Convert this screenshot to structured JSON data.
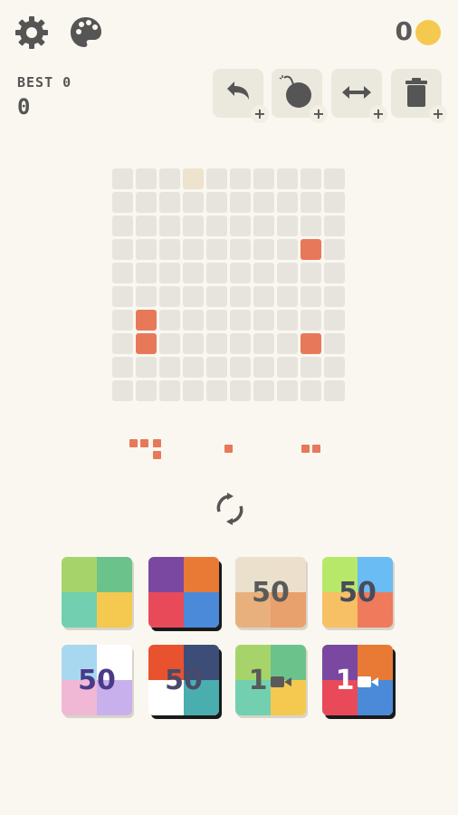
{
  "header": {
    "settings_icon": "gear-icon",
    "palette_icon": "palette-icon",
    "coins": "0",
    "coin_color": "#f5c84f"
  },
  "stats": {
    "best_label": "BEST 0",
    "score": "0"
  },
  "tools": [
    {
      "name": "undo",
      "icon": "undo-icon",
      "plus": "+"
    },
    {
      "name": "bomb",
      "icon": "bomb-icon",
      "plus": "+"
    },
    {
      "name": "swap",
      "icon": "swap-arrows-icon",
      "plus": "+"
    },
    {
      "name": "trash",
      "icon": "trash-icon",
      "plus": "+"
    }
  ],
  "board": {
    "rows": 10,
    "cols": 10,
    "empty_color": "#e6e4dc",
    "filled_color": "#e8785a",
    "highlight_color": "#eee3cd",
    "highlight_cells": [
      [
        0,
        3
      ]
    ],
    "filled_cells": [
      [
        3,
        8
      ],
      [
        6,
        1
      ],
      [
        7,
        1
      ],
      [
        7,
        8
      ]
    ]
  },
  "tray": {
    "piece_color": "#e8785a",
    "refresh_icon": "refresh-icon"
  },
  "themes": [
    {
      "colors": [
        "#a6d46a",
        "#6cc28b",
        "#72d0b0",
        "#f5c84f"
      ],
      "price": "",
      "style": "soft"
    },
    {
      "colors": [
        "#7a48a0",
        "#e87a35",
        "#e84a5a",
        "#4a8ad8"
      ],
      "style": "dark",
      "price": ""
    },
    {
      "colors": [
        "#eae0cc",
        "#ece0cc",
        "#e8b07c",
        "#e8a06c"
      ],
      "price": "50",
      "price_color": "#5a5a5a",
      "style": "soft"
    },
    {
      "colors": [
        "#b8e86a",
        "#6abcf4",
        "#f8c064",
        "#f07a5c"
      ],
      "price": "50",
      "price_color": "#4a4a5a",
      "style": "soft"
    },
    {
      "colors": [
        "#a8d8f0",
        "#ffffff",
        "#f0b8d4",
        "#c8b0ec"
      ],
      "price": "50",
      "price_color": "#4a3a8a",
      "style": "soft"
    },
    {
      "colors": [
        "#e8522e",
        "#3c4e78",
        "#ffffff",
        "#4aaeae"
      ],
      "price": "50",
      "price_color": "#4a4a6a",
      "style": "dark"
    },
    {
      "colors": [
        "#a6d46a",
        "#6cc28b",
        "#72d0b0",
        "#f5c84f"
      ],
      "price": "1",
      "price_color": "#5a5a5a",
      "video": true,
      "style": "soft"
    },
    {
      "colors": [
        "#7a48a0",
        "#e87a35",
        "#e84a5a",
        "#4a8ad8"
      ],
      "price": "1",
      "price_color": "#ffffff",
      "video": true,
      "style": "dark"
    }
  ]
}
